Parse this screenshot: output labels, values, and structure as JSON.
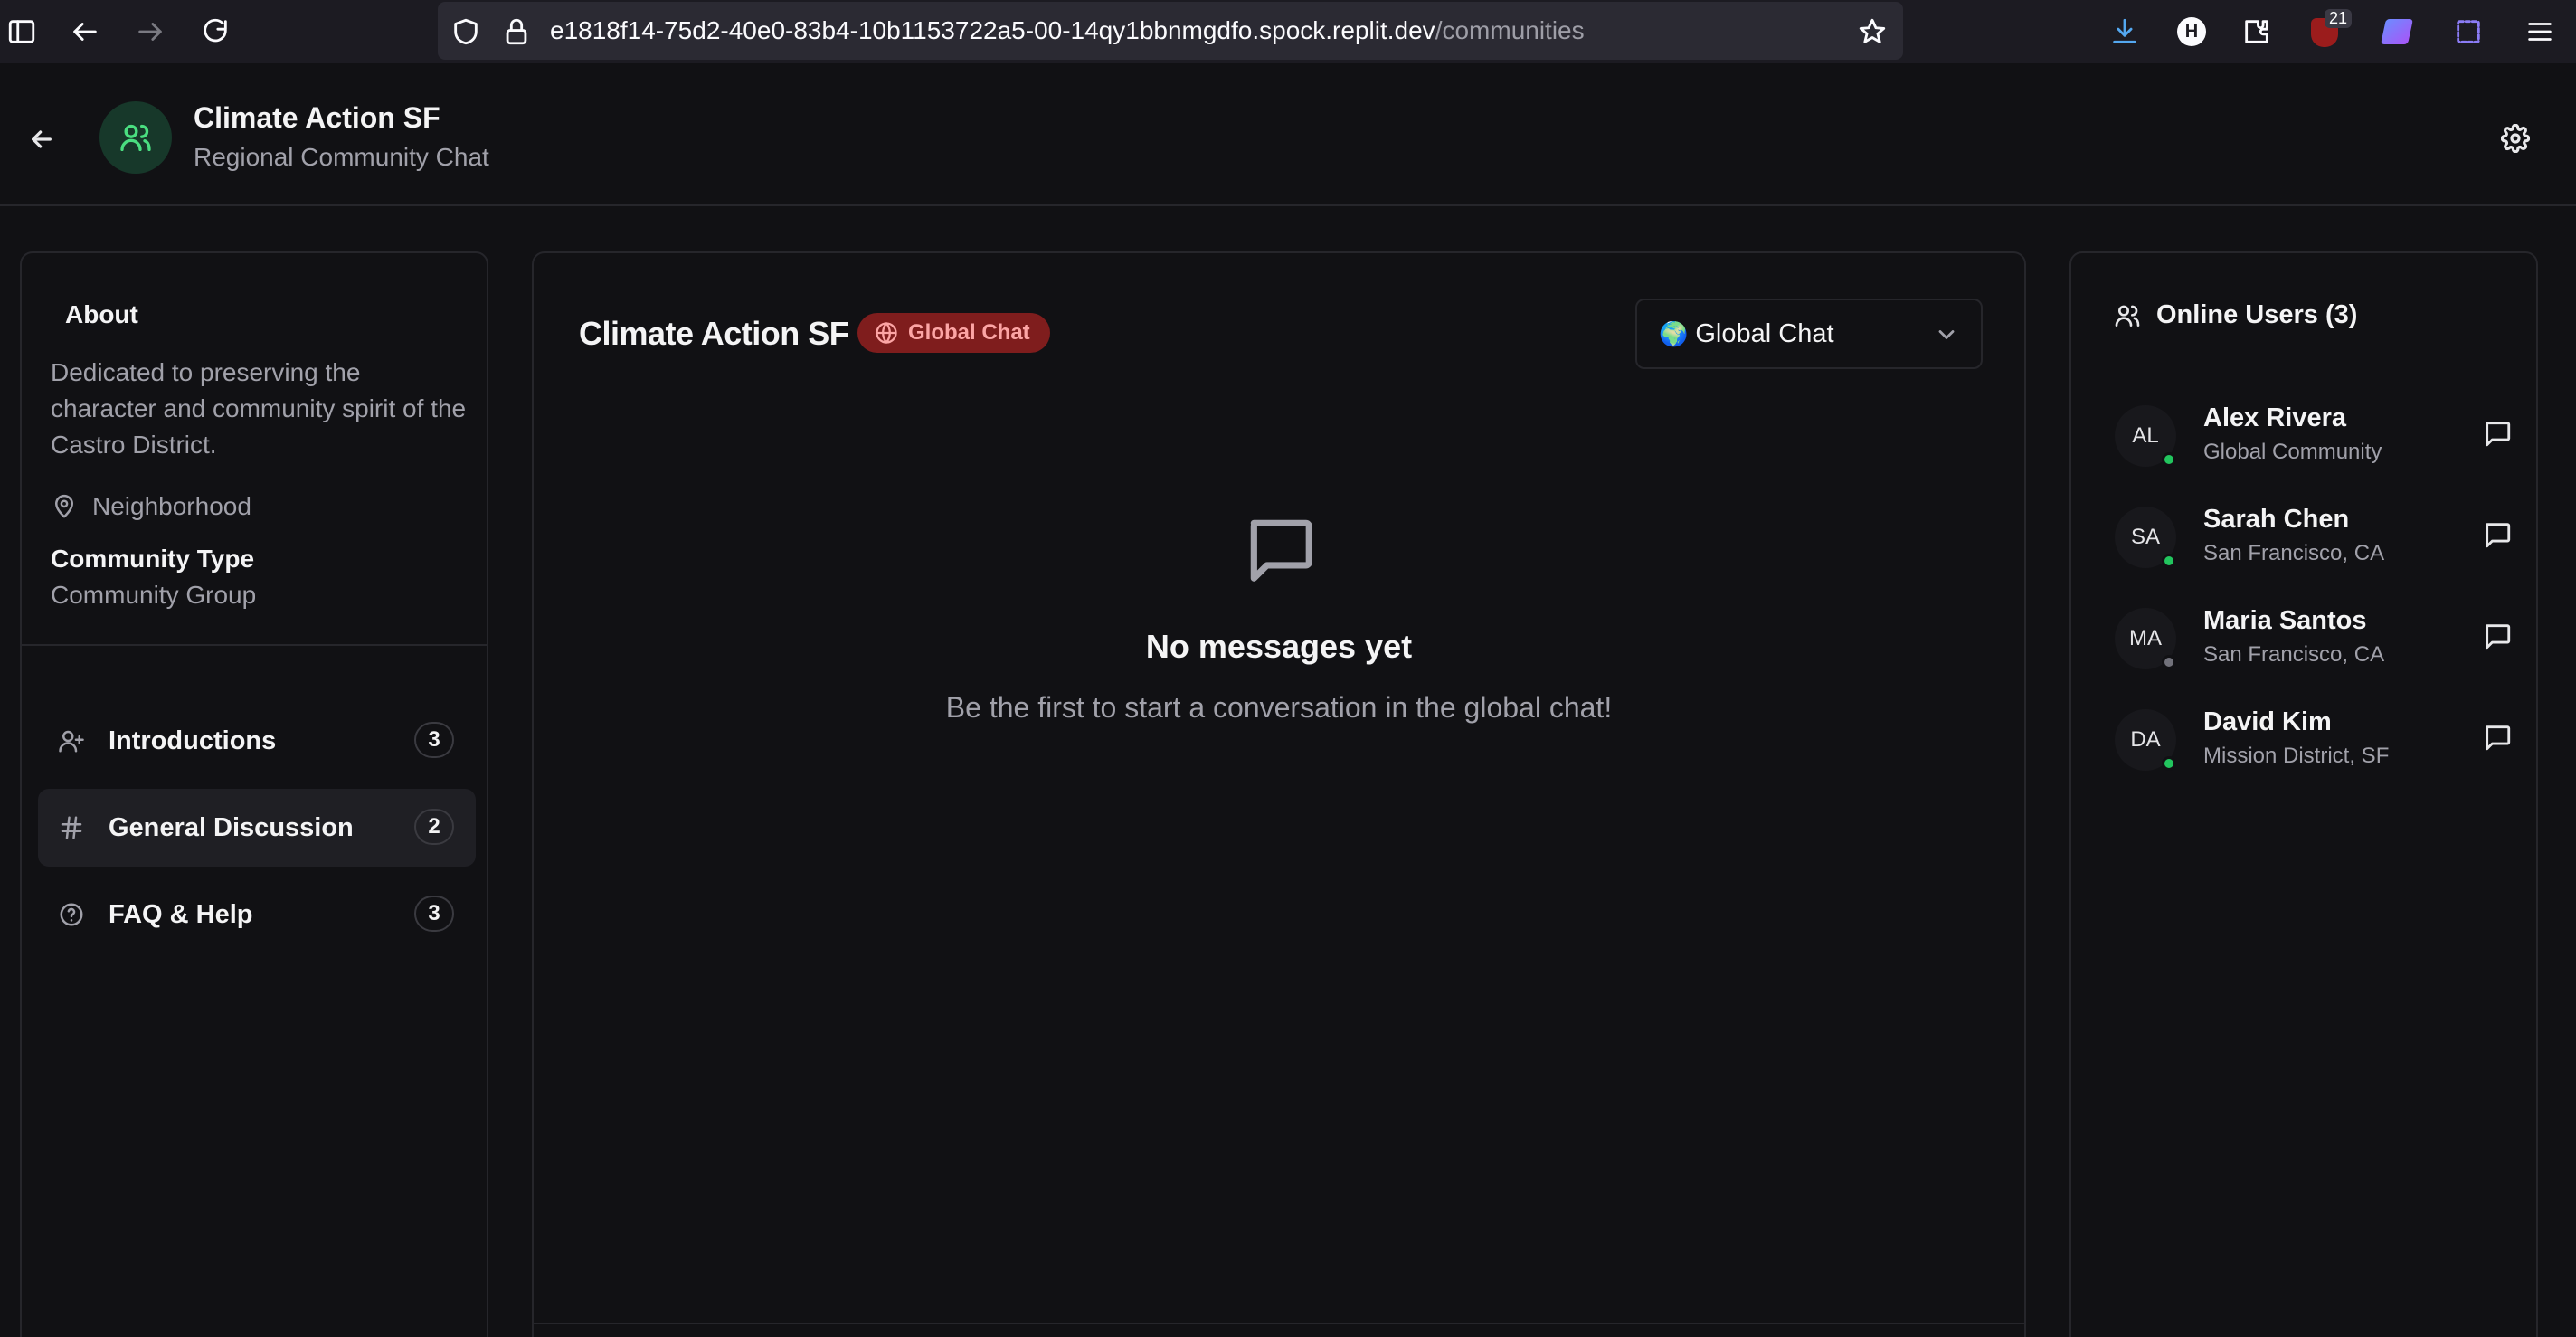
{
  "browser": {
    "url_host": "e1818f14-75d2-40e0-83b4-10b1153722a5-00-14qy1bbnmgdfo.spock.replit.dev",
    "url_path": "/communities",
    "extension_badge": "21"
  },
  "header": {
    "title": "Climate Action SF",
    "subtitle": "Regional Community Chat"
  },
  "sidebar": {
    "about_title": "About",
    "description": "Dedicated to preserving the character and community spirit of the Castro District.",
    "location": "Neighborhood",
    "type_label": "Community Type",
    "type_value": "Community Group",
    "channels": [
      {
        "label": "Introductions",
        "count": "3",
        "icon": "user-plus-icon"
      },
      {
        "label": "General Discussion",
        "count": "2",
        "icon": "hash-icon"
      },
      {
        "label": "FAQ & Help",
        "count": "3",
        "icon": "help-circle-icon"
      }
    ]
  },
  "chat": {
    "title": "Climate Action SF",
    "badge": "Global Chat",
    "select_icon": "🌍",
    "select_value": "Global Chat",
    "empty_title": "No messages yet",
    "empty_subtitle": "Be the first to start a conversation in the global chat!"
  },
  "online": {
    "title": "Online Users (3)",
    "users": [
      {
        "initials": "AL",
        "name": "Alex Rivera",
        "location": "Global Community",
        "status_color": "#22c55e"
      },
      {
        "initials": "SA",
        "name": "Sarah Chen",
        "location": "San Francisco, CA",
        "status_color": "#22c55e"
      },
      {
        "initials": "MA",
        "name": "Maria Santos",
        "location": "San Francisco, CA",
        "status_color": "#71717a"
      },
      {
        "initials": "DA",
        "name": "David Kim",
        "location": "Mission District, SF",
        "status_color": "#22c55e"
      }
    ]
  },
  "colors": {
    "background": "#111114",
    "accent_green": "#4ade80",
    "badge_bg": "#7f1d1d",
    "badge_text": "#fca5a5"
  }
}
